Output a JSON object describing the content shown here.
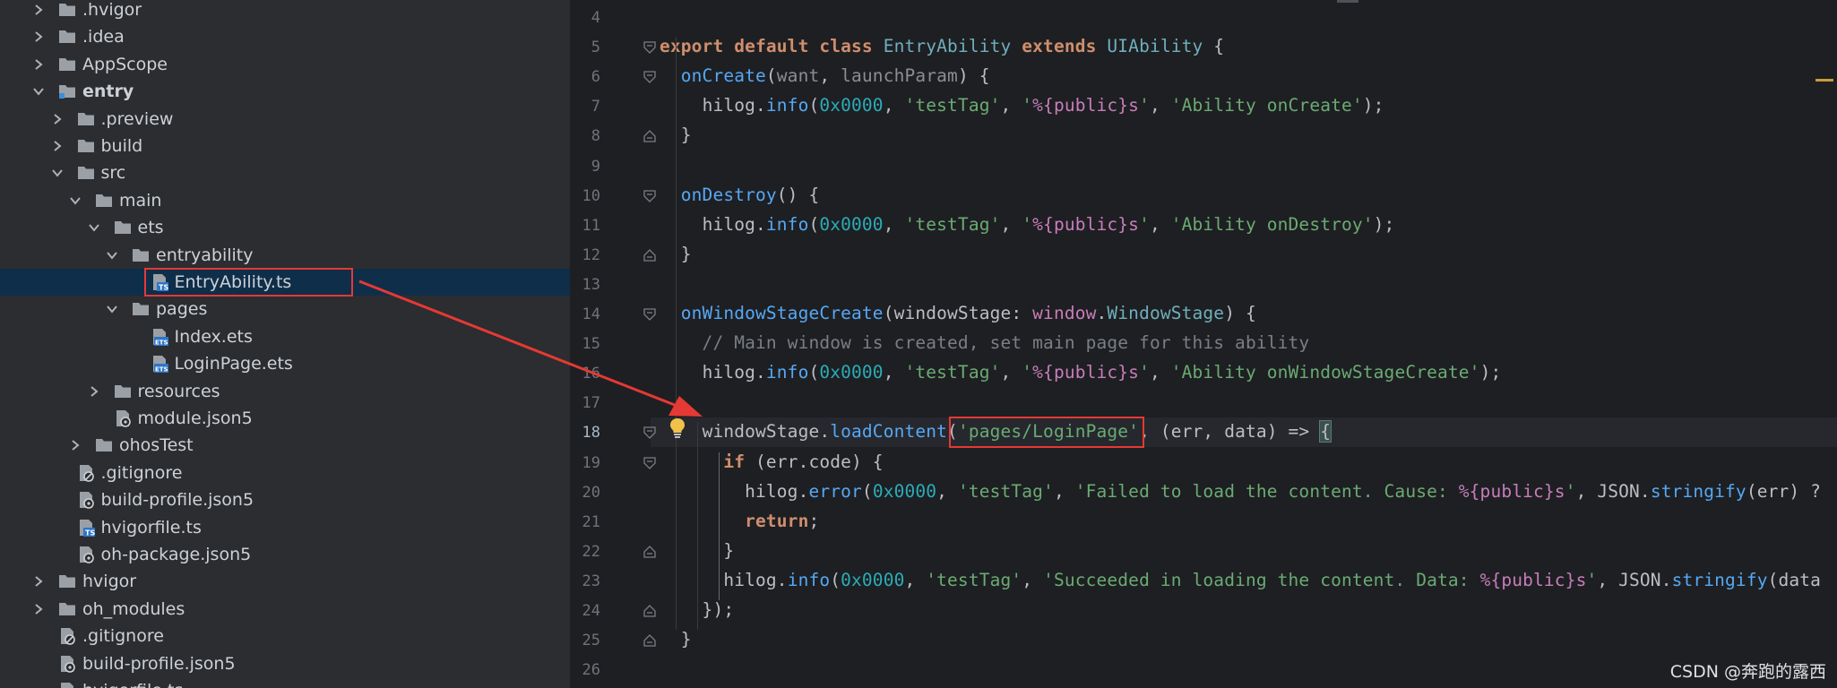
{
  "project_tree": {
    "items": [
      {
        "label": ".hvigor",
        "depth": 0,
        "expanded": false,
        "icon": "folder-icon",
        "chev": "right"
      },
      {
        "label": ".idea",
        "depth": 0,
        "expanded": false,
        "icon": "folder-icon",
        "chev": "right"
      },
      {
        "label": "AppScope",
        "depth": 0,
        "expanded": false,
        "icon": "folder-icon",
        "chev": "right"
      },
      {
        "label": "entry",
        "depth": 0,
        "expanded": true,
        "icon": "module-folder-icon",
        "chev": "down",
        "bold": true
      },
      {
        "label": ".preview",
        "depth": 1,
        "expanded": false,
        "icon": "folder-icon",
        "chev": "right"
      },
      {
        "label": "build",
        "depth": 1,
        "expanded": false,
        "icon": "folder-icon",
        "chev": "right"
      },
      {
        "label": "src",
        "depth": 1,
        "expanded": true,
        "icon": "folder-icon",
        "chev": "down"
      },
      {
        "label": "main",
        "depth": 2,
        "expanded": true,
        "icon": "folder-icon",
        "chev": "down"
      },
      {
        "label": "ets",
        "depth": 3,
        "expanded": true,
        "icon": "folder-icon",
        "chev": "down"
      },
      {
        "label": "entryability",
        "depth": 4,
        "expanded": true,
        "icon": "folder-icon",
        "chev": "down"
      },
      {
        "label": "EntryAbility.ts",
        "depth": 5,
        "icon": "ts-file-icon",
        "chev": "none",
        "selected": true
      },
      {
        "label": "pages",
        "depth": 4,
        "expanded": true,
        "icon": "folder-icon",
        "chev": "down"
      },
      {
        "label": "Index.ets",
        "depth": 5,
        "icon": "ets-file-icon",
        "chev": "none"
      },
      {
        "label": "LoginPage.ets",
        "depth": 5,
        "icon": "ets-file-icon",
        "chev": "none"
      },
      {
        "label": "resources",
        "depth": 3,
        "expanded": false,
        "icon": "folder-icon",
        "chev": "right"
      },
      {
        "label": "module.json5",
        "depth": 3,
        "icon": "json-file-icon",
        "chev": "none"
      },
      {
        "label": "ohosTest",
        "depth": 2,
        "expanded": false,
        "icon": "folder-icon",
        "chev": "right"
      },
      {
        "label": ".gitignore",
        "depth": 1,
        "icon": "gitignore-file-icon",
        "chev": "none"
      },
      {
        "label": "build-profile.json5",
        "depth": 1,
        "icon": "json-file-icon",
        "chev": "none"
      },
      {
        "label": "hvigorfile.ts",
        "depth": 1,
        "icon": "ts-file-icon",
        "chev": "none"
      },
      {
        "label": "oh-package.json5",
        "depth": 1,
        "icon": "json-file-icon",
        "chev": "none"
      },
      {
        "label": "hvigor",
        "depth": 0,
        "expanded": false,
        "icon": "folder-icon",
        "chev": "right"
      },
      {
        "label": "oh_modules",
        "depth": 0,
        "expanded": false,
        "icon": "folder-icon",
        "chev": "right"
      },
      {
        "label": ".gitignore",
        "depth": 0,
        "icon": "gitignore-file-icon",
        "chev": "none"
      },
      {
        "label": "build-profile.json5",
        "depth": 0,
        "icon": "json-file-icon",
        "chev": "none"
      },
      {
        "label": "hvigorfile.ts",
        "depth": 0,
        "icon": "ts-file-icon",
        "chev": "none"
      }
    ]
  },
  "editor": {
    "current_line": 18,
    "lines": [
      {
        "n": "4",
        "code": ""
      },
      {
        "n": "5",
        "code": "export default class EntryAbility extends UIAbility {"
      },
      {
        "n": "6",
        "code": "  onCreate(want, launchParam) {"
      },
      {
        "n": "7",
        "code": "    hilog.info(0x0000, 'testTag', '%{public}s', 'Ability onCreate');"
      },
      {
        "n": "8",
        "code": "  }"
      },
      {
        "n": "9",
        "code": ""
      },
      {
        "n": "10",
        "code": "  onDestroy() {"
      },
      {
        "n": "11",
        "code": "    hilog.info(0x0000, 'testTag', '%{public}s', 'Ability onDestroy');"
      },
      {
        "n": "12",
        "code": "  }"
      },
      {
        "n": "13",
        "code": ""
      },
      {
        "n": "14",
        "code": "  onWindowStageCreate(windowStage: window.WindowStage) {"
      },
      {
        "n": "15",
        "code": "    // Main window is created, set main page for this ability"
      },
      {
        "n": "16",
        "code": "    hilog.info(0x0000, 'testTag', '%{public}s', 'Ability onWindowStageCreate');"
      },
      {
        "n": "17",
        "code": ""
      },
      {
        "n": "18",
        "code": "    windowStage.loadContent('pages/LoginPage', (err, data) => {"
      },
      {
        "n": "19",
        "code": "      if (err.code) {"
      },
      {
        "n": "20",
        "code": "        hilog.error(0x0000, 'testTag', 'Failed to load the content. Cause: %{public}s', JSON.stringify(err) ?"
      },
      {
        "n": "21",
        "code": "        return;"
      },
      {
        "n": "22",
        "code": "      }"
      },
      {
        "n": "23",
        "code": "      hilog.info(0x0000, 'testTag', 'Succeeded in loading the content. Data: %{public}s', JSON.stringify(data"
      },
      {
        "n": "24",
        "code": "    });"
      },
      {
        "n": "25",
        "code": "  }"
      },
      {
        "n": "26",
        "code": ""
      }
    ]
  },
  "watermark": "CSDN @奔跑的露西",
  "colors": {
    "annotation_red": "#e53935",
    "selection_bg": "#0f2e4a",
    "editor_bg": "#1e1f22",
    "tree_bg": "#2b2d30"
  }
}
